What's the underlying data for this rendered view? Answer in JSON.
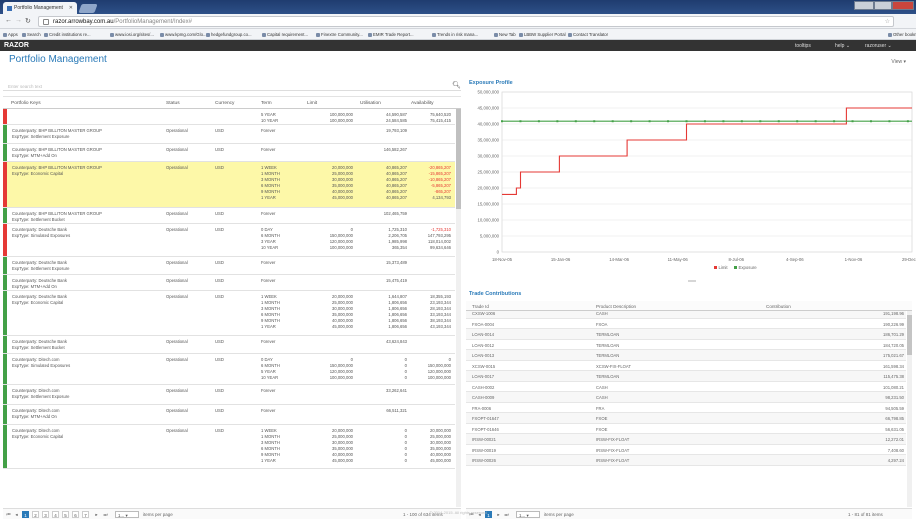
{
  "browser": {
    "tab_title": "Portfolio Management",
    "url_host": "razor.arrowbay.com.au",
    "url_path": "/PortfolioManagement/Index#",
    "bookmarks": [
      "Apps",
      "Search",
      "Credit institutions re...",
      "www.iosi.org/sites/...",
      "www.kpmg.com/Glo...",
      "hedgefundgroup.co...",
      "Capital requirement...",
      "Finextre Community...",
      "EMIR Trade Report...",
      "Trends in risk mana...",
      "New Tab",
      "LBBW Supplier Portal",
      "Contact Translator",
      "Other bookmarks"
    ]
  },
  "app": {
    "brand": "RAZOR",
    "menu_tooltips": "tooltips",
    "menu_help": "help ⌄",
    "menu_user": "razoruser ⌄",
    "page_title": "Portfolio Management",
    "view_menu": "View ▾"
  },
  "grid": {
    "search_placeholder": "Enter search text",
    "columns": [
      "Portfolio Keys",
      "Status",
      "Currency",
      "Term",
      "Limit",
      "Utilisation",
      "Availability"
    ],
    "rows": [
      {
        "bar": "#e53935",
        "hl": false,
        "key": "",
        "key2": "",
        "status": "",
        "currency": "",
        "terms": [
          "5 YEAR",
          "10 YEAR"
        ],
        "limits": [
          "100,000,000",
          "100,000,000"
        ],
        "utils": [
          "44,590,587",
          "24,584,585"
        ],
        "avails": [
          "75,640,520",
          "75,415,415"
        ],
        "neg": [
          false,
          false
        ],
        "h": 16
      },
      {
        "bar": "#43a047",
        "hl": false,
        "key": "Counterparty: BHP BILLITON MASTER GROUP",
        "key2": "ExpType: Settlement Exposure",
        "status": "Operational",
        "currency": "USD",
        "terms": [
          "Forever"
        ],
        "limits": [
          ""
        ],
        "utils": [
          "19,793,109"
        ],
        "avails": [
          ""
        ],
        "neg": [
          false
        ],
        "h": 19
      },
      {
        "bar": "#43a047",
        "hl": false,
        "key": "Counterparty: BHP BILLITON MASTER GROUP",
        "key2": "ExpType: MTM+Add On",
        "status": "Operational",
        "currency": "USD",
        "terms": [
          "Forever"
        ],
        "limits": [
          ""
        ],
        "utils": [
          "146,582,267"
        ],
        "avails": [
          ""
        ],
        "neg": [
          false
        ],
        "h": 18
      },
      {
        "bar": "#e53935",
        "hl": true,
        "key": "Counterparty: BHP BILLITON MASTER GROUP",
        "key2": "ExpType: Economic Capital",
        "status": "Operational",
        "currency": "USD",
        "terms": [
          "1 WEEK",
          "1 MONTH",
          "3 MONTH",
          "6 MONTH",
          "9 MONTH",
          "1 YEAR"
        ],
        "limits": [
          "20,000,000",
          "25,000,000",
          "30,000,000",
          "35,000,000",
          "40,000,000",
          "45,000,000"
        ],
        "utils": [
          "40,865,207",
          "40,865,207",
          "40,865,207",
          "40,865,207",
          "40,865,207",
          "40,865,207"
        ],
        "avails": [
          "-20,865,207",
          "-15,865,207",
          "-10,865,207",
          "-5,865,207",
          "-865,207",
          "4,134,793"
        ],
        "neg": [
          true,
          true,
          true,
          true,
          true,
          false
        ],
        "h": 46
      },
      {
        "bar": "#43a047",
        "hl": false,
        "key": "Counterparty: BHP BILLITON MASTER GROUP",
        "key2": "ExpType: Settlement Bucket",
        "status": "Operational",
        "currency": "USD",
        "terms": [
          "Forever"
        ],
        "limits": [
          ""
        ],
        "utils": [
          "102,465,759"
        ],
        "avails": [
          ""
        ],
        "neg": [
          false
        ],
        "h": 16
      },
      {
        "bar": "#e53935",
        "hl": false,
        "key": "Counterparty: Deutsche Bank",
        "key2": "ExpType: Simulated Exposures",
        "status": "Operational",
        "currency": "USD",
        "terms": [
          "0 DAY",
          "6 MONTH",
          "3 YEAR",
          "10 YEAR"
        ],
        "limits": [
          "0",
          "150,000,000",
          "120,000,000",
          "100,000,000"
        ],
        "utils": [
          "1,725,310",
          "2,206,705",
          "1,985,998",
          "365,354"
        ],
        "avails": [
          "-1,725,310",
          "147,793,295",
          "118,014,002",
          "99,634,646"
        ],
        "neg": [
          true,
          false,
          false,
          false
        ],
        "h": 33
      },
      {
        "bar": "#43a047",
        "hl": false,
        "key": "Counterparty: Deutsche Bank",
        "key2": "ExpType: Settlement Exposure",
        "status": "Operational",
        "currency": "USD",
        "terms": [
          "Forever"
        ],
        "limits": [
          ""
        ],
        "utils": [
          "15,373,489"
        ],
        "avails": [
          ""
        ],
        "neg": [
          false
        ],
        "h": 18
      },
      {
        "bar": "#43a047",
        "hl": false,
        "key": "Counterparty: Deutsche Bank",
        "key2": "ExpType: MTM+Add On",
        "status": "Operational",
        "currency": "USD",
        "terms": [
          "Forever"
        ],
        "limits": [
          ""
        ],
        "utils": [
          "15,475,419"
        ],
        "avails": [
          ""
        ],
        "neg": [
          false
        ],
        "h": 16
      },
      {
        "bar": "#43a047",
        "hl": false,
        "key": "Counterparty: Deutsche Bank",
        "key2": "ExpType: Economic Capital",
        "status": "Operational",
        "currency": "USD",
        "terms": [
          "1 WEEK",
          "1 MONTH",
          "3 MONTH",
          "6 MONTH",
          "9 MONTH",
          "1 YEAR"
        ],
        "limits": [
          "20,000,000",
          "25,000,000",
          "30,000,000",
          "35,000,000",
          "40,000,000",
          "45,000,000"
        ],
        "utils": [
          "1,644,807",
          "1,806,656",
          "1,806,656",
          "1,806,656",
          "1,806,656",
          "1,806,656"
        ],
        "avails": [
          "18,355,193",
          "23,193,344",
          "28,193,344",
          "33,193,344",
          "38,193,344",
          "43,193,344"
        ],
        "neg": [
          false,
          false,
          false,
          false,
          false,
          false
        ],
        "h": 45
      },
      {
        "bar": "#43a047",
        "hl": false,
        "key": "Counterparty: Deutsche Bank",
        "key2": "ExpType: Settlement Bucket",
        "status": "Operational",
        "currency": "USD",
        "terms": [
          "Forever"
        ],
        "limits": [
          ""
        ],
        "utils": [
          "43,624,843"
        ],
        "avails": [
          ""
        ],
        "neg": [
          false
        ],
        "h": 18
      },
      {
        "bar": "#43a047",
        "hl": false,
        "key": "Counterparty: Ditech.com",
        "key2": "ExpType: Simulated Exposures",
        "status": "Operational",
        "currency": "USD",
        "terms": [
          "0 DAY",
          "6 MONTH",
          "5 YEAR",
          "10 YEAR"
        ],
        "limits": [
          "0",
          "150,000,000",
          "120,000,000",
          "100,000,000"
        ],
        "utils": [
          "0",
          "0",
          "0",
          "0"
        ],
        "avails": [
          "0",
          "150,000,000",
          "120,000,000",
          "100,000,000"
        ],
        "neg": [
          false,
          false,
          false,
          false
        ],
        "h": 31
      },
      {
        "bar": "#43a047",
        "hl": false,
        "key": "Counterparty: Ditech.com",
        "key2": "ExpType: Settlement Exposure",
        "status": "Operational",
        "currency": "USD",
        "terms": [
          "Forever"
        ],
        "limits": [
          ""
        ],
        "utils": [
          "33,262,641"
        ],
        "avails": [
          ""
        ],
        "neg": [
          false
        ],
        "h": 20
      },
      {
        "bar": "#43a047",
        "hl": false,
        "key": "Counterparty: Ditech.com",
        "key2": "ExpType: MTM+Add On",
        "status": "Operational",
        "currency": "USD",
        "terms": [
          "Forever"
        ],
        "limits": [
          ""
        ],
        "utils": [
          "66,511,321"
        ],
        "avails": [
          ""
        ],
        "neg": [
          false
        ],
        "h": 20
      },
      {
        "bar": "#43a047",
        "hl": false,
        "key": "Counterparty: Ditech.com",
        "key2": "ExpType: Economic Capital",
        "status": "Operational",
        "currency": "USD",
        "terms": [
          "1 WEEK",
          "1 MONTH",
          "3 MONTH",
          "6 MONTH",
          "9 MONTH",
          "1 YEAR"
        ],
        "limits": [
          "20,000,000",
          "25,000,000",
          "30,000,000",
          "35,000,000",
          "40,000,000",
          "45,000,000"
        ],
        "utils": [
          "0",
          "0",
          "0",
          "0",
          "0",
          "0"
        ],
        "avails": [
          "20,000,000",
          "25,000,000",
          "30,000,000",
          "35,000,000",
          "40,000,000",
          "45,000,000"
        ],
        "neg": [
          false,
          false,
          false,
          false,
          false,
          false
        ],
        "h": 44
      }
    ],
    "pager": {
      "pages": [
        "1",
        "2",
        "3",
        "4",
        "5",
        "6",
        "7"
      ],
      "page_size": "1...",
      "items_label": "items per page",
      "summary": "1 - 100 of 634 items"
    }
  },
  "exposure": {
    "title": "Exposure Profile"
  },
  "chart_data": {
    "type": "line",
    "title": "Exposure Profile",
    "y_ticks": [
      "50,000,000",
      "45,000,000",
      "40,000,000",
      "35,000,000",
      "30,000,000",
      "25,000,000",
      "20,000,000",
      "15,000,000",
      "10,000,000",
      "5,000,000",
      "0"
    ],
    "x_ticks": [
      "18-Nov-05",
      "15-Jan-06",
      "14-Mar-06",
      "11-May-06",
      "8-Jul-06",
      "4-Sep-06",
      "1-Nov-06",
      "29-Dec-06"
    ],
    "ylim": [
      0,
      50000000
    ],
    "legend": [
      "Limit",
      "Exposure"
    ],
    "legend_position": "bottom",
    "colors": {
      "Limit": "#e53935",
      "Exposure": "#43a047"
    },
    "series": [
      {
        "name": "Limit",
        "points": [
          [
            0.0,
            18000000
          ],
          [
            0.035,
            18000000
          ],
          [
            0.035,
            20000000
          ],
          [
            0.045,
            20000000
          ],
          [
            0.045,
            25000000
          ],
          [
            0.14,
            25000000
          ],
          [
            0.14,
            30000000
          ],
          [
            0.305,
            30000000
          ],
          [
            0.305,
            35000000
          ],
          [
            0.45,
            35000000
          ],
          [
            0.45,
            40000000
          ],
          [
            0.84,
            40000000
          ],
          [
            0.84,
            45000000
          ],
          [
            1.0,
            45000000
          ]
        ]
      },
      {
        "name": "Exposure",
        "points": [
          [
            0.0,
            40865207
          ],
          [
            1.0,
            40865207
          ]
        ]
      }
    ]
  },
  "trades": {
    "title": "Trade Contributions",
    "columns": [
      "Trade Id",
      "Product Description",
      "Contribution"
    ],
    "rows": [
      [
        "CXSW-1006",
        "CASH",
        "191,198.96"
      ],
      [
        "FXOA-0004",
        "FXOA",
        "190,226.99"
      ],
      [
        "LOAN-0014",
        "TERMLOAN",
        "186,701.29"
      ],
      [
        "LOAN-0012",
        "TERMLOAN",
        "184,720.05"
      ],
      [
        "LOAN-0013",
        "TERMLOAN",
        "175,021.67"
      ],
      [
        "XCSW-0015",
        "XCSW-FIX-FLOAT",
        "161,598.34"
      ],
      [
        "LOAN-0017",
        "TERMLOAN",
        "115,475.38"
      ],
      [
        "CASH-0002",
        "CASH",
        "101,080.21"
      ],
      [
        "CASH-0009",
        "CASH",
        "98,231.50"
      ],
      [
        "FRA-0006",
        "FRA",
        "94,505.59"
      ],
      [
        "FXOPT-01647",
        "FXOE",
        "66,798.85"
      ],
      [
        "FXOPT-01646",
        "FXOE",
        "56,631.05"
      ],
      [
        "IRSW-00021",
        "IRSW-FIX-FLOAT",
        "12,272.01"
      ],
      [
        "IRSW-00019",
        "IRSW-FIX-FLOAT",
        "7,408.60"
      ],
      [
        "IRSW-00026",
        "IRSW-FIX-FLOAT",
        "4,297.24"
      ]
    ],
    "pager": {
      "page": "1",
      "page_size": "1...",
      "items_label": "items per page",
      "summary": "1 - 81 of 81 items"
    }
  },
  "footer": {
    "copyright": "© 2014-2015. All rights reserved"
  }
}
